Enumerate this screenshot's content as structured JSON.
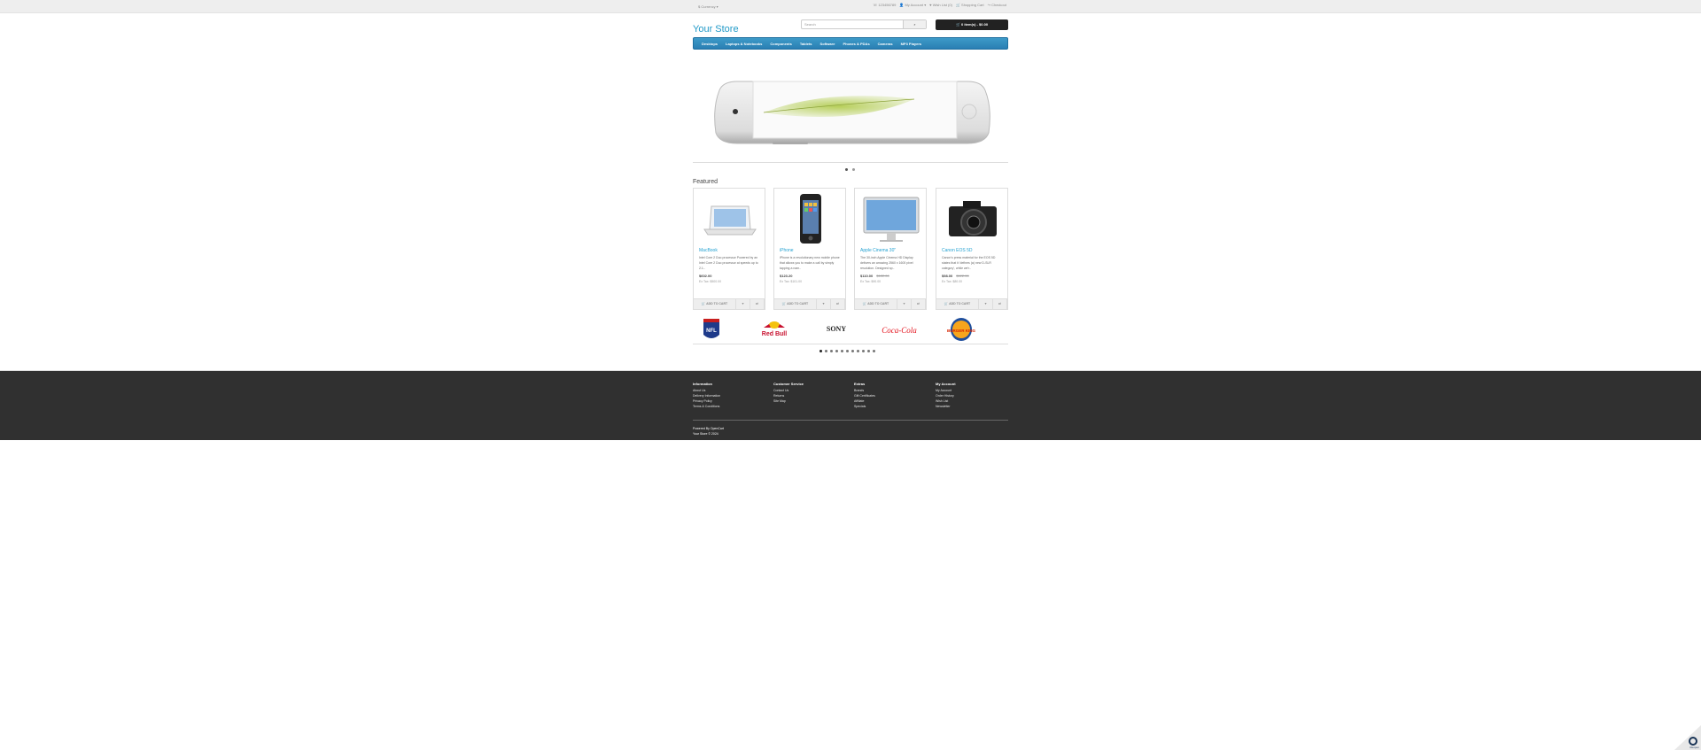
{
  "topbar": {
    "currency": "$ Currency ▾",
    "phone": "☏ 123456789",
    "account": "My Account ▾",
    "wishlist": "♥ Wish List (0)",
    "cart": "Shopping Cart",
    "checkout": "Checkout"
  },
  "header": {
    "logo": "Your Store",
    "search_placeholder": "Search",
    "search_button": "⌕",
    "cart_button": "0 item(s) - $0.00"
  },
  "menu": [
    "Desktops",
    "Laptops & Notebooks",
    "Components",
    "Tablets",
    "Software",
    "Phones & PDAs",
    "Cameras",
    "MP3 Players"
  ],
  "featured": {
    "title": "Featured",
    "products": [
      {
        "name": "MacBook",
        "desc": "Intel Core 2 Duo processor Powered by an Intel Core 2 Duo processor at speeds up to 2.1..",
        "price": "$602.00",
        "old_price": "",
        "tax": "Ex Tax: $500.00"
      },
      {
        "name": "iPhone",
        "desc": "iPhone is a revolutionary new mobile phone that allows you to make a call by simply tapping a nam..",
        "price": "$123.20",
        "old_price": "",
        "tax": "Ex Tax: $101.00"
      },
      {
        "name": "Apple Cinema 30\"",
        "desc": "The 30-inch Apple Cinema HD Display delivers an amazing 2560 x 1600 pixel resolution. Designed sp..",
        "price": "$110.00",
        "old_price": "$122.00",
        "tax": "Ex Tax: $90.00"
      },
      {
        "name": "Canon EOS 5D",
        "desc": "Canon's press material for the EOS 5D states that it 'defines (a) new D-SLR category', while we'r..",
        "price": "$98.00",
        "old_price": "$122.00",
        "tax": "Ex Tax: $80.00"
      }
    ],
    "add_to_cart": "🛒 ADD TO CART",
    "wish": "♥",
    "compare": "⇄"
  },
  "brands": [
    "NFL",
    "Red Bull",
    "SONY",
    "Coca-Cola",
    "BURGER KING"
  ],
  "footer": {
    "cols": [
      {
        "title": "Information",
        "links": [
          "About Us",
          "Delivery Information",
          "Privacy Policy",
          "Terms & Conditions"
        ]
      },
      {
        "title": "Customer Service",
        "links": [
          "Contact Us",
          "Returns",
          "Site Map"
        ]
      },
      {
        "title": "Extras",
        "links": [
          "Brands",
          "Gift Certificates",
          "Affiliate",
          "Specials"
        ]
      },
      {
        "title": "My Account",
        "links": [
          "My Account",
          "Order History",
          "Wish List",
          "Newsletter"
        ]
      }
    ],
    "powered": "Powered By OpenCart",
    "store": "Your Store © 2024"
  },
  "corner": {
    "label": "Reopen"
  }
}
